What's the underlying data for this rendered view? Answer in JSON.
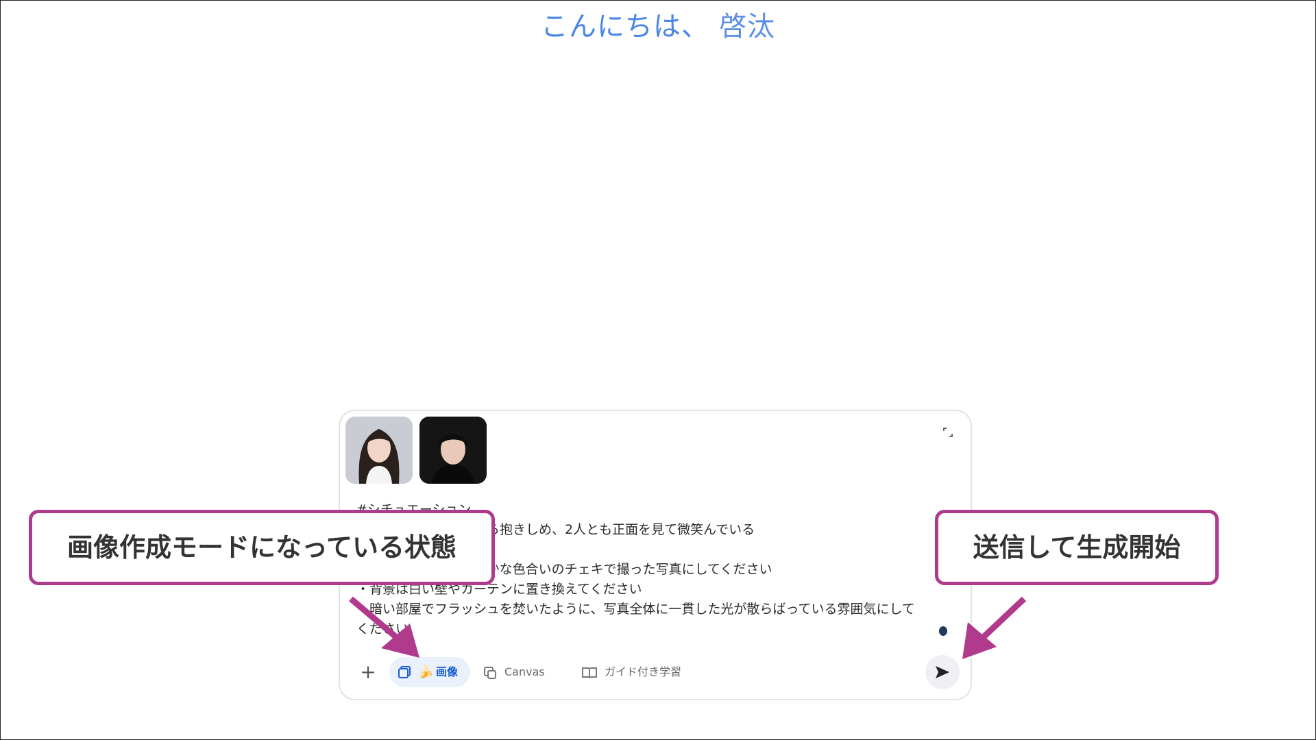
{
  "greeting": {
    "hello": "こんにちは、",
    "name": "啓汰"
  },
  "composer": {
    "attachments": [
      {
        "name": "woman-portrait"
      },
      {
        "name": "man-portrait"
      }
    ],
    "prompt_text": "#シチュエーション\n・男性が女性を後ろから抱きしめ、2人とも正面を見て微笑んでいる\n\n・ヴィンテージ風の温かな色合いのチェキで撮った写真にしてください\n・背景は白い壁やカーテンに置き換えてください\n・暗い部屋でフラッシュを焚いたように、写真全体に一貫した光が散らばっている雰囲気にして\nください",
    "toolbar": {
      "plus": "+",
      "image_mode_label": "画像",
      "image_emoji": "🍌",
      "canvas_label": "Canvas",
      "guided_label": "ガイド付き学習"
    }
  },
  "annotations": {
    "left": "画像作成モードになっている状態",
    "right": "送信して生成開始"
  },
  "colors": {
    "accent_blue": "#4a86e8",
    "callout_border": "#b03a8c",
    "chip_bg": "#eaf1fd"
  }
}
